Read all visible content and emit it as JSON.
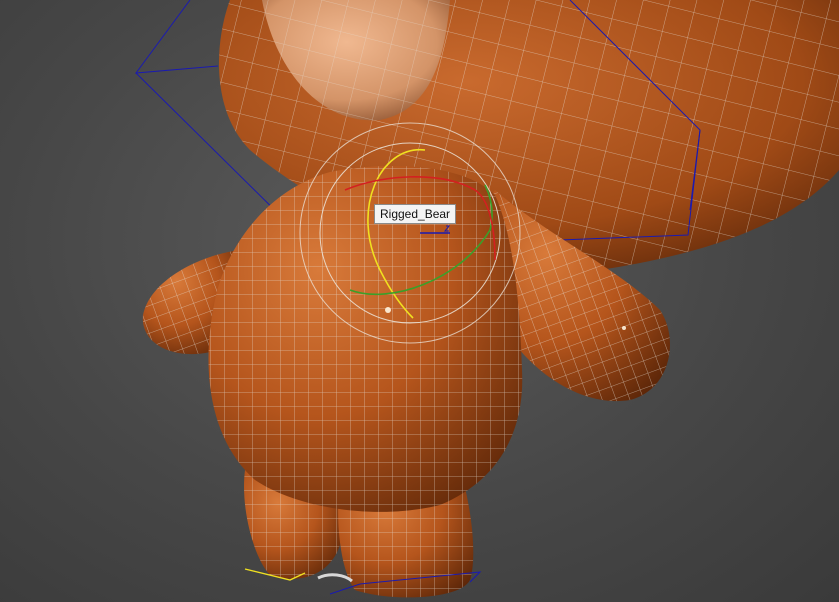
{
  "viewport": {
    "tooltip": "Rigged_Bear"
  },
  "colors": {
    "background": "#474747",
    "bear_body": "#b5551c",
    "wireframe": "#e8e2d8",
    "selection_box": "#1a1ab0",
    "gizmo_x": "#d42020",
    "gizmo_y": "#3aa02a",
    "gizmo_z": "#f0e020"
  }
}
